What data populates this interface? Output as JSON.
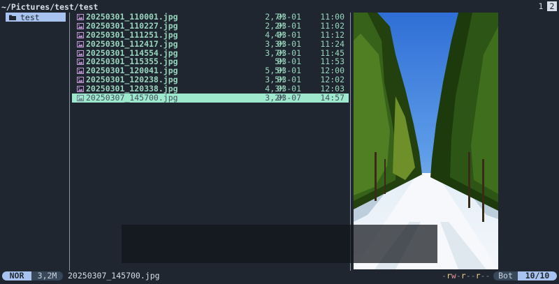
{
  "header": {
    "path": "~/Pictures/test/test",
    "tabs": [
      {
        "label": "1",
        "active": false
      },
      {
        "label": "2",
        "active": true
      }
    ]
  },
  "parent_pane": {
    "items": [
      {
        "label": "test",
        "icon": "folder-icon",
        "selected": true
      }
    ]
  },
  "files": [
    {
      "name": "20250301_110001.jpg",
      "size": "2,7M",
      "date": "03-01",
      "time": "11:00",
      "icon": "image-icon"
    },
    {
      "name": "20250301_110227.jpg",
      "size": "2,2M",
      "date": "03-01",
      "time": "11:02",
      "icon": "image-icon"
    },
    {
      "name": "20250301_111251.jpg",
      "size": "4,4M",
      "date": "03-01",
      "time": "11:12",
      "icon": "image-icon"
    },
    {
      "name": "20250301_112417.jpg",
      "size": "3,3M",
      "date": "03-01",
      "time": "11:24",
      "icon": "image-icon"
    },
    {
      "name": "20250301_114554.jpg",
      "size": "3,7M",
      "date": "03-01",
      "time": "11:45",
      "icon": "image-icon"
    },
    {
      "name": "20250301_115355.jpg",
      "size": "5M",
      "date": "03-01",
      "time": "11:53",
      "icon": "image-icon"
    },
    {
      "name": "20250301_120041.jpg",
      "size": "5,5M",
      "date": "03-01",
      "time": "12:00",
      "icon": "image-icon"
    },
    {
      "name": "20250301_120238.jpg",
      "size": "3,5M",
      "date": "03-01",
      "time": "12:02",
      "icon": "image-icon"
    },
    {
      "name": "20250301_120338.jpg",
      "size": "4,3M",
      "date": "03-01",
      "time": "12:03",
      "icon": "image-icon"
    },
    {
      "name": "20250307_145700.jpg",
      "size": "3,2M",
      "date": "03-07",
      "time": "14:57",
      "icon": "image-icon",
      "selected": true
    }
  ],
  "status": {
    "mode": "NOR",
    "size": "3,2M",
    "filename": "20250307_145700.jpg",
    "perms": "-rw-r--r--",
    "position": "Bot",
    "count": "10/10"
  },
  "colors": {
    "background": "#1f2630",
    "accent": "#a8c3ef",
    "selection": "#9ee8cd",
    "file_text": "#9ad6be",
    "image_icon": "#c39ad8"
  }
}
